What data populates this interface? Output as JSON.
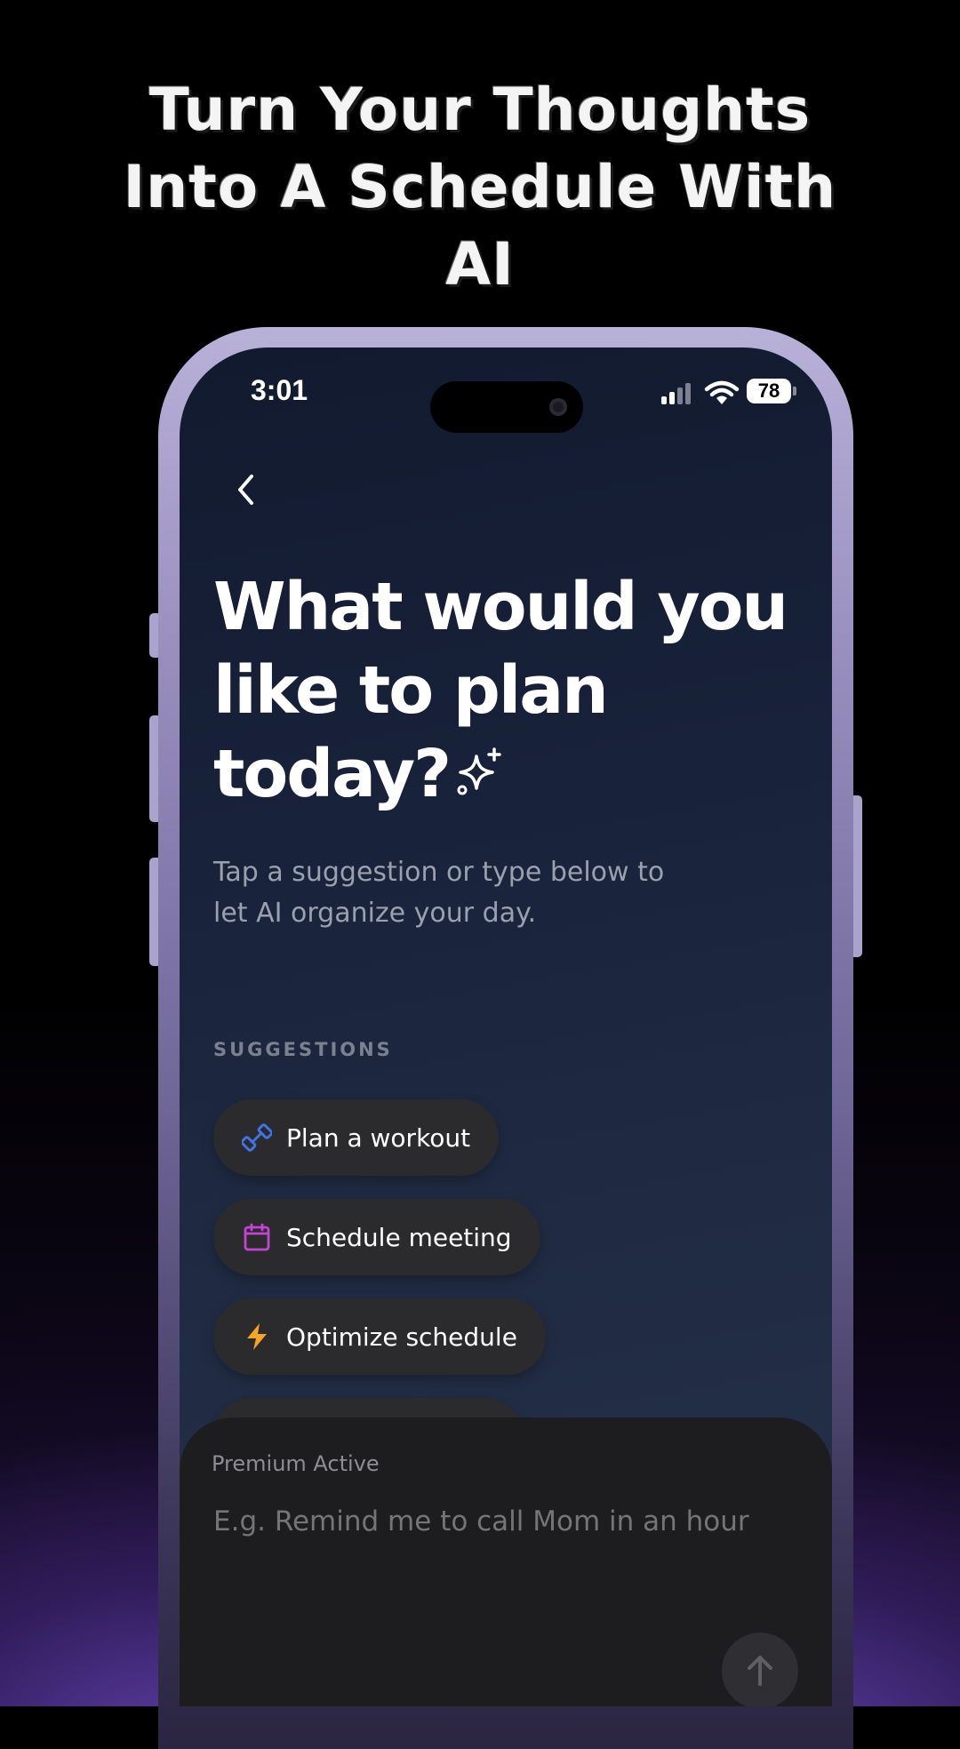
{
  "headline": {
    "line1": "Turn Your Thoughts",
    "line2": "Into A Schedule With",
    "line3": "AI"
  },
  "status_bar": {
    "time": "3:01",
    "battery": "78"
  },
  "screen": {
    "title_line1": "What would you",
    "title_line2": "like to plan",
    "title_line3": "today?",
    "subtitle_line1": "Tap a suggestion or type below to",
    "subtitle_line2": "let AI organize your day.",
    "section_label": "SUGGESTIONS",
    "suggestions": [
      {
        "label": "Plan a workout",
        "icon": "dumbbell-icon",
        "color": "#3f73e6"
      },
      {
        "label": "Schedule meeting",
        "icon": "calendar-icon",
        "color": "#c743d6"
      },
      {
        "label": "Optimize schedule",
        "icon": "lightning-icon",
        "color": "#f5a524"
      }
    ]
  },
  "composer": {
    "status": "Premium Active",
    "placeholder": "E.g. Remind me to call Mom in an hour"
  },
  "colors": {
    "accent_purple": "#6a4bb0",
    "phone_frame": "#b8b1d8"
  }
}
